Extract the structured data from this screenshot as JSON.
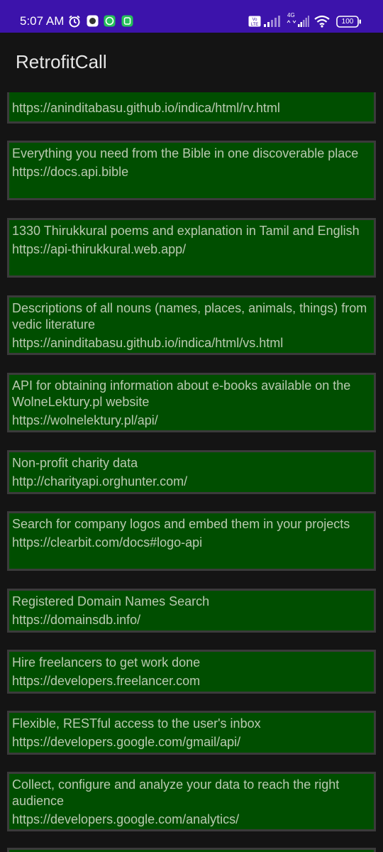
{
  "status_bar": {
    "time": "5:07 AM",
    "battery": "100",
    "network": "4G",
    "colors": {
      "background": "#3c13ab"
    },
    "icons": [
      "alarm-icon",
      "app-icon",
      "whatsapp-icon",
      "message-icon",
      "volte-icon",
      "signal-icon",
      "signal-icon",
      "wifi-icon",
      "battery-icon"
    ]
  },
  "app_bar": {
    "title": "RetrofitCall"
  },
  "items": [
    {
      "desc": "",
      "url": "https://aninditabasu.github.io/indica/html/rv.html"
    },
    {
      "desc": "Everything you need from the Bible in one discoverable place",
      "url": "https://docs.api.bible"
    },
    {
      "desc": "1330 Thirukkural poems and explanation in Tamil and English",
      "url": "https://api-thirukkural.web.app/"
    },
    {
      "desc": "Descriptions of all nouns (names, places, animals, things) from vedic literature",
      "url": "https://aninditabasu.github.io/indica/html/vs.html"
    },
    {
      "desc": "API for obtaining information about e-books available on the WolneLektury.pl website",
      "url": "https://wolnelektury.pl/api/"
    },
    {
      "desc": "Non-profit charity data",
      "url": "http://charityapi.orghunter.com/"
    },
    {
      "desc": "Search for company logos and embed them in your projects",
      "url": "https://clearbit.com/docs#logo-api"
    },
    {
      "desc": "Registered Domain Names Search",
      "url": "https://domainsdb.info/"
    },
    {
      "desc": "Hire freelancers to get work done",
      "url": "https://developers.freelancer.com"
    },
    {
      "desc": "Flexible, RESTful access to the user's inbox",
      "url": "https://developers.google.com/gmail/api/"
    },
    {
      "desc": "Collect, configure and analyze your data to reach the right audience",
      "url": "https://developers.google.com/analytics/"
    }
  ],
  "colors": {
    "card_background": "#004e00",
    "card_border": "#3b3b3b",
    "text": "#b9c9b0",
    "screen_background": "#141414"
  }
}
